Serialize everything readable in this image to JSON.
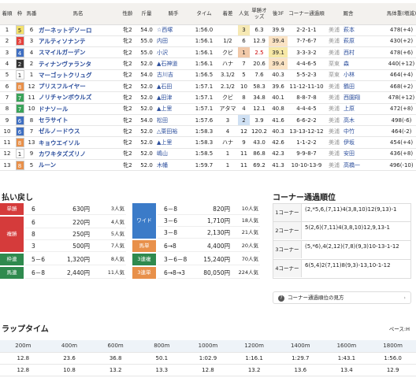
{
  "results": {
    "headers": [
      "着順",
      "枠",
      "馬番",
      "馬名",
      "性齢",
      "斤量",
      "騎手",
      "タイム",
      "着差",
      "人気",
      "単勝オッズ",
      "後3F",
      "コーナー通過順",
      "厩舎",
      "馬体重(増減)"
    ],
    "rows": [
      {
        "rank": "1",
        "waku": "5",
        "waku_bg": "#f3e16a",
        "waku_fg": "#222",
        "num": "6",
        "name": "ガーネットデソーロ",
        "sex": "牝2",
        "weight": "54.0",
        "jockey": "☆西塚",
        "time": "1:56.0",
        "margin": "",
        "pop": "3",
        "odds": "6.3",
        "l3f": "39.9",
        "corner": "2-2-1-1",
        "stable_area": "美浦",
        "trainer": "萩本",
        "body": "478(+4)"
      },
      {
        "rank": "2",
        "waku": "3",
        "waku_bg": "#e5413b",
        "waku_fg": "#fff",
        "num": "3",
        "name": "アルティソナンテ",
        "sex": "牝2",
        "weight": "55.0",
        "jockey": "内田",
        "time": "1:56.1",
        "margin": "1/2",
        "pop": "6",
        "odds": "12.9",
        "l3f": "39.4",
        "corner": "7-7-6-7",
        "stable_area": "美浦",
        "trainer": "萩原",
        "body": "430(+2)"
      },
      {
        "rank": "3",
        "waku": "4",
        "waku_bg": "#3f6fc2",
        "waku_fg": "#fff",
        "num": "4",
        "name": "スマイルガーデン",
        "sex": "牝2",
        "weight": "55.0",
        "jockey": "小沢",
        "time": "1:56.1",
        "margin": "クビ",
        "pop": "1",
        "odds": "2.5",
        "l3f": "39.1",
        "corner": "3-3-3-2",
        "stable_area": "美浦",
        "trainer": "西村",
        "body": "478(+6)"
      },
      {
        "rank": "4",
        "waku": "2",
        "waku_bg": "#333",
        "waku_fg": "#fff",
        "num": "2",
        "name": "ティナンヴァランタ",
        "sex": "牝2",
        "weight": "52.0",
        "jockey": "▲石神道",
        "time": "1:56.1",
        "margin": "ハナ",
        "pop": "7",
        "odds": "20.6",
        "l3f": "39.4",
        "corner": "4-4-6-5",
        "stable_area": "栗東",
        "trainer": "森",
        "body": "440(+12)"
      },
      {
        "rank": "5",
        "waku": "1",
        "waku_bg": "#ffffff",
        "waku_fg": "#222",
        "num": "1",
        "name": "マーゴットクリュグ",
        "sex": "牝2",
        "weight": "54.0",
        "jockey": "古川吉",
        "time": "1:56.5",
        "margin": "3.1/2",
        "pop": "5",
        "odds": "7.6",
        "l3f": "40.3",
        "corner": "5-5-2-3",
        "stable_area": "栗東",
        "trainer": "小林",
        "body": "464(+4)"
      },
      {
        "rank": "6",
        "waku": "8",
        "waku_bg": "#e8904a",
        "waku_fg": "#fff",
        "num": "12",
        "name": "プリスフルイヤー",
        "sex": "牝2",
        "weight": "52.0",
        "jockey": "▲石田",
        "time": "1:57.1",
        "margin": "2.1/2",
        "pop": "10",
        "odds": "58.3",
        "l3f": "39.6",
        "corner": "11-12-11-10",
        "stable_area": "美浦",
        "trainer": "鶴田",
        "body": "468(+2)"
      },
      {
        "rank": "7",
        "waku": "7",
        "waku_bg": "#3aa35a",
        "waku_fg": "#fff",
        "num": "11",
        "name": "ノリチャンボウルズ",
        "sex": "牝2",
        "weight": "52.0",
        "jockey": "▲田津",
        "time": "1:57.1",
        "margin": "クビ",
        "pop": "8",
        "odds": "34.8",
        "l3f": "40.1",
        "corner": "8-8-7-8",
        "stable_area": "美浦",
        "trainer": "西園翔",
        "body": "478(+12)"
      },
      {
        "rank": "8",
        "waku": "7",
        "waku_bg": "#3aa35a",
        "waku_fg": "#fff",
        "num": "10",
        "name": "ドナソール",
        "sex": "牝2",
        "weight": "52.0",
        "jockey": "▲上里",
        "time": "1:57.1",
        "margin": "アタマ",
        "pop": "4",
        "odds": "12.1",
        "l3f": "40.8",
        "corner": "4-4-4-5",
        "stable_area": "美浦",
        "trainer": "上原",
        "body": "472(+8)"
      },
      {
        "rank": "9",
        "waku": "6",
        "waku_bg": "#3f6fc2",
        "waku_fg": "#fff",
        "num": "8",
        "name": "セラサイト",
        "sex": "牝2",
        "weight": "54.0",
        "jockey": "松田",
        "time": "1:57.6",
        "margin": "3",
        "pop": "2",
        "odds": "3.9",
        "l3f": "41.6",
        "corner": "6-6-2-2",
        "stable_area": "美浦",
        "trainer": "高木",
        "body": "498(-6)"
      },
      {
        "rank": "10",
        "waku": "6",
        "waku_bg": "#3f6fc2",
        "waku_fg": "#fff",
        "num": "7",
        "name": "ゼルノードウス",
        "sex": "牝2",
        "weight": "52.0",
        "jockey": "△栗田裕",
        "time": "1:58.3",
        "margin": "4",
        "pop": "12",
        "odds": "120.2",
        "l3f": "40.3",
        "corner": "13-13-12-12",
        "stable_area": "美浦",
        "trainer": "中竹",
        "body": "464(-2)"
      },
      {
        "rank": "11",
        "waku": "8",
        "waku_bg": "#e8904a",
        "waku_fg": "#fff",
        "num": "13",
        "name": "キョウエイソル",
        "sex": "牝2",
        "weight": "52.0",
        "jockey": "▲上里",
        "time": "1:58.3",
        "margin": "ハナ",
        "pop": "9",
        "odds": "43.0",
        "l3f": "42.6",
        "corner": "1-1-2-2",
        "stable_area": "美浦",
        "trainer": "伊坂",
        "body": "454(+4)"
      },
      {
        "rank": "12",
        "waku": "1",
        "waku_bg": "#ffffff",
        "waku_fg": "#222",
        "num": "9",
        "name": "カワキタズズリノ",
        "sex": "牝2",
        "weight": "52.0",
        "jockey": "嶋山",
        "time": "1:58.5",
        "margin": "1",
        "pop": "11",
        "odds": "86.8",
        "l3f": "42.3",
        "corner": "9-9-8-7",
        "stable_area": "美浦",
        "trainer": "安田",
        "body": "436(+8)"
      },
      {
        "rank": "13",
        "waku": "8",
        "waku_bg": "#e8904a",
        "waku_fg": "#fff",
        "num": "5",
        "name": "ルーン",
        "sex": "牝2",
        "weight": "52.0",
        "jockey": "木幡",
        "time": "1:59.7",
        "margin": "1",
        "pop": "11",
        "odds": "69.2",
        "l3f": "41.3",
        "corner": "10-10-13-9",
        "stable_area": "美浦",
        "trainer": "高橋一",
        "body": "496(-10)"
      }
    ]
  },
  "payout": {
    "title": "払い戻し",
    "left": [
      {
        "type": "単勝",
        "color": "#d53b3b",
        "lines": [
          {
            "combo": "6",
            "amount": "630円",
            "pop": "3人気"
          }
        ]
      },
      {
        "type": "複勝",
        "color": "#d53b3b",
        "lines": [
          {
            "combo": "6",
            "amount": "220円",
            "pop": "4人気"
          },
          {
            "combo": "8",
            "amount": "250円",
            "pop": "5人気"
          },
          {
            "combo": "3",
            "amount": "500円",
            "pop": "7人気"
          }
        ]
      },
      {
        "type": "枠連",
        "color": "#2f8a4e",
        "lines": [
          {
            "combo": "5－6",
            "amount": "1,320円",
            "pop": "8人気"
          }
        ]
      },
      {
        "type": "馬連",
        "color": "#2f8a4e",
        "lines": [
          {
            "combo": "6－8",
            "amount": "2,440円",
            "pop": "11人気"
          }
        ]
      }
    ],
    "right": [
      {
        "type": "ワイド",
        "color": "#3b7bc8",
        "lines": [
          {
            "combo": "6－8",
            "amount": "820円",
            "pop": "10人気"
          },
          {
            "combo": "3－6",
            "amount": "1,710円",
            "pop": "18人気"
          },
          {
            "combo": "3－8",
            "amount": "2,130円",
            "pop": "21人気"
          }
        ]
      },
      {
        "type": "馬単",
        "color": "#e8904a",
        "lines": [
          {
            "combo": "6→8",
            "amount": "4,400円",
            "pop": "20人気"
          }
        ]
      },
      {
        "type": "3連複",
        "color": "#2f8a4e",
        "lines": [
          {
            "combo": "3－6－8",
            "amount": "15,240円",
            "pop": "70人気"
          }
        ]
      },
      {
        "type": "3連単",
        "color": "#e8904a",
        "lines": [
          {
            "combo": "6→8→3",
            "amount": "80,050円",
            "pop": "224人気"
          }
        ]
      }
    ]
  },
  "corner": {
    "title": "コーナー通過順位",
    "rows": [
      {
        "label": "1コーナー",
        "text": "(2,*5,6,(7,11)4(3,8,10)12(9,13)-1"
      },
      {
        "label": "2コーナー",
        "text": "5(2,6)(7,11)4(3,8,10)12,9,13-1"
      },
      {
        "label": "3コーナー",
        "text": "(5,*6),4(2,12)(7,8)(9,3)10-13-1-12"
      },
      {
        "label": "4コーナー",
        "text": "6(5,4)2(7,11)8(9,3)-13,10-1-12"
      }
    ],
    "help_link": "コーナー通過順位の見方"
  },
  "laps": {
    "title": "ラップタイム",
    "pace": "ペース:H",
    "headers": [
      "200m",
      "400m",
      "600m",
      "800m",
      "1000m",
      "1200m",
      "1400m",
      "1600m",
      "1800m"
    ],
    "cumulative": [
      "12.8",
      "23.6",
      "36.8",
      "50.1",
      "1:02.9",
      "1:16.1",
      "1:29.7",
      "1:43.1",
      "1:56.0"
    ],
    "split": [
      "12.8",
      "10.8",
      "13.2",
      "13.3",
      "12.8",
      "13.2",
      "13.6",
      "13.4",
      "12.9"
    ]
  }
}
